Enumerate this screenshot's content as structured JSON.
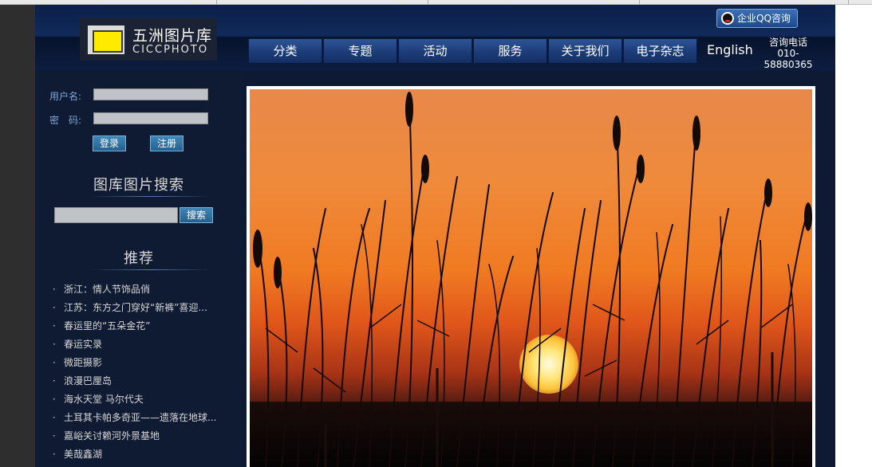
{
  "header": {
    "logo_cn": "五洲图片库",
    "logo_en": "CICCPHOTO",
    "qq_button": "企业QQ咨询",
    "nav": [
      "分类",
      "专题",
      "活动",
      "服务",
      "关于我们",
      "电子杂志"
    ],
    "english": "English",
    "contact_label": "咨询电话",
    "contact_phone": "010-58880365"
  },
  "login": {
    "username_label": "用户名:",
    "password_label": "密　码:",
    "login_button": "登录",
    "register_button": "注册"
  },
  "search": {
    "title": "图库图片搜索",
    "button": "搜索"
  },
  "recommend": {
    "title": "推荐",
    "items": [
      "浙江：情人节饰品俏",
      "江苏：东方之门穿好“新裤”喜迎...",
      "春运里的“五朵金花”",
      "春运实录",
      "微距摄影",
      "浪漫巴厘岛",
      "海水天堂 马尔代夫",
      "土耳其卡帕多奇亚——遗落在地球...",
      "嘉峪关讨赖河外景基地",
      "美哉鑫湖"
    ]
  },
  "colors": {
    "page_bg": "#0e1a33",
    "nav_bg": "#1c3c78",
    "label_blue": "#7fa6d8",
    "button_blue": "#24608e"
  }
}
